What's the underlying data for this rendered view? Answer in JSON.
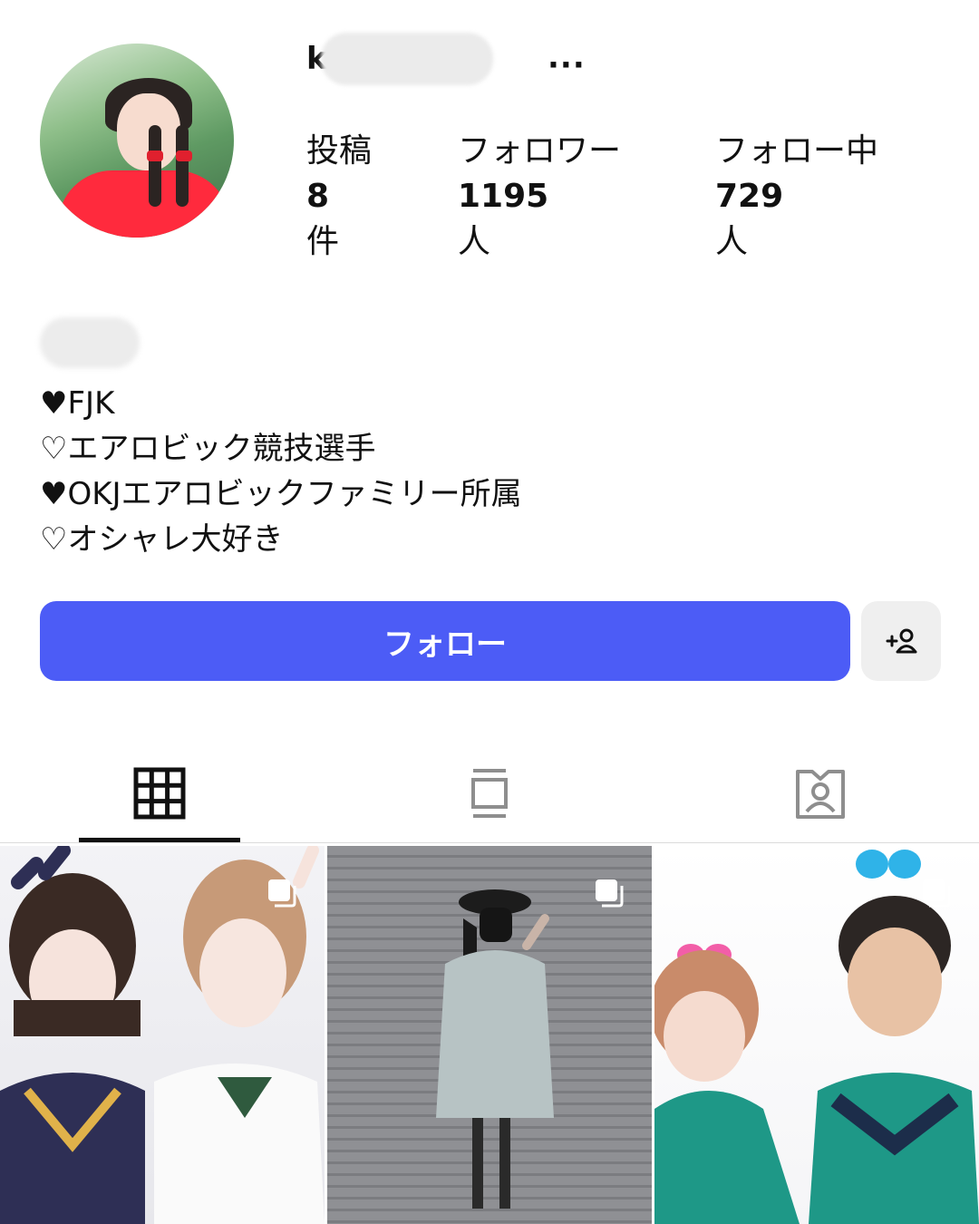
{
  "profile": {
    "username": "k       0",
    "more_label": "···"
  },
  "stats": [
    {
      "label": "投稿",
      "value": "8",
      "unit": "件"
    },
    {
      "label": "フォロワー",
      "value": "1195",
      "unit": "人"
    },
    {
      "label": "フォロー中",
      "value": "729",
      "unit": "人"
    }
  ],
  "bio": {
    "lines": [
      "♥FJK",
      "♡エアロビック競技選手",
      "♥OKJエアロビックファミリー所属",
      "♡オシャレ大好き"
    ]
  },
  "actions": {
    "follow_label": "フォロー",
    "suggest_icon": "add-person-icon"
  },
  "tabs": [
    {
      "name": "grid",
      "icon": "grid-icon",
      "active": true
    },
    {
      "name": "reels",
      "icon": "reels-icon",
      "active": false
    },
    {
      "name": "tagged",
      "icon": "tagged-person-icon",
      "active": false
    }
  ],
  "colors": {
    "follow_button": "#4c5cf6",
    "suggest_button": "#efefef"
  }
}
